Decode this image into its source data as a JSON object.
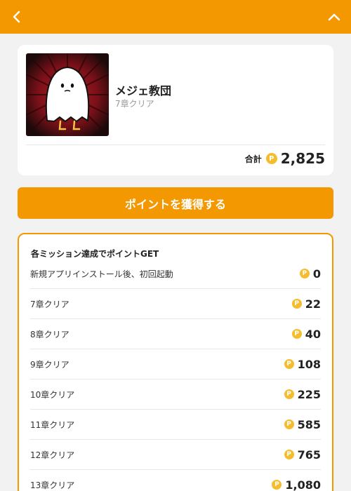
{
  "header": {
    "back_icon": "chevron-left-icon",
    "collapse_icon": "chevron-up-icon",
    "background": "#f39800"
  },
  "profile": {
    "name": "メジェ教団",
    "progress": "7章クリア",
    "avatar": "ghost-avatar",
    "total_label": "合計",
    "total_points": "2,825",
    "coin_symbol": "P"
  },
  "cta": {
    "label": "ポイントを獲得する"
  },
  "missions": {
    "title": "各ミッション達成でポイントGET",
    "coin_symbol": "P",
    "items": [
      {
        "label": "新規アプリインストール後、初回起動",
        "points": "0"
      },
      {
        "label": "7章クリア",
        "points": "22"
      },
      {
        "label": "8章クリア",
        "points": "40"
      },
      {
        "label": "9章クリア",
        "points": "108"
      },
      {
        "label": "10章クリア",
        "points": "225"
      },
      {
        "label": "11章クリア",
        "points": "585"
      },
      {
        "label": "12章クリア",
        "points": "765"
      },
      {
        "label": "13章クリア",
        "points": "1,080"
      }
    ]
  },
  "colors": {
    "accent": "#f39800",
    "coin": "#f5bd2e",
    "background": "#f2f2f2"
  }
}
